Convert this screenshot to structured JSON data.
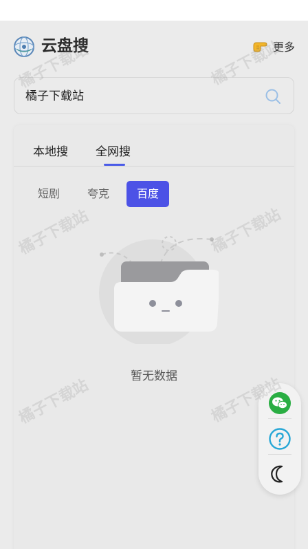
{
  "app": {
    "title": "云盘搜",
    "logo": "globe-logo-icon"
  },
  "header": {
    "more_label": "更多",
    "more_icon": "pointing-hand-icon"
  },
  "search": {
    "value": "橘子下载站",
    "icon": "search-icon"
  },
  "tabs": [
    {
      "label": "本地搜",
      "active": false
    },
    {
      "label": "全网搜",
      "active": true
    }
  ],
  "sources": [
    {
      "label": "短剧",
      "active": false
    },
    {
      "label": "夸克",
      "active": false
    },
    {
      "label": "百度",
      "active": true
    }
  ],
  "empty": {
    "text": "暂无数据",
    "icon": "empty-folder-icon"
  },
  "float_buttons": [
    {
      "icon": "wechat-icon",
      "color": "#2aae43"
    },
    {
      "icon": "help-circle-icon",
      "color": "#27a7d6"
    },
    {
      "icon": "moon-icon",
      "color": "#222222"
    }
  ],
  "colors": {
    "accent": "#4c52e6",
    "background": "#ebebeb"
  },
  "watermark": "橘子下载站"
}
